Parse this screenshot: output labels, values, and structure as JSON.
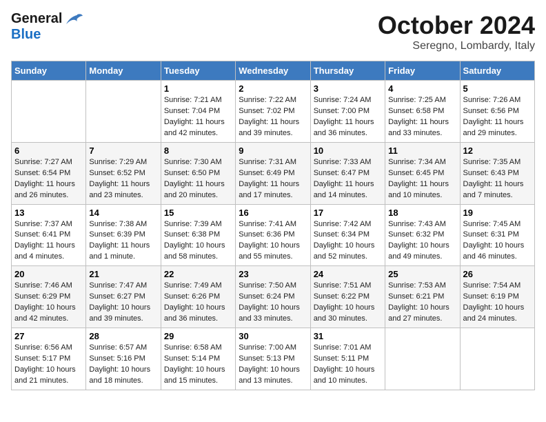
{
  "logo": {
    "general": "General",
    "blue": "Blue"
  },
  "title": "October 2024",
  "subtitle": "Seregno, Lombardy, Italy",
  "days_of_week": [
    "Sunday",
    "Monday",
    "Tuesday",
    "Wednesday",
    "Thursday",
    "Friday",
    "Saturday"
  ],
  "weeks": [
    [
      {
        "day": "",
        "sunrise": "",
        "sunset": "",
        "daylight": ""
      },
      {
        "day": "",
        "sunrise": "",
        "sunset": "",
        "daylight": ""
      },
      {
        "day": "1",
        "sunrise": "Sunrise: 7:21 AM",
        "sunset": "Sunset: 7:04 PM",
        "daylight": "Daylight: 11 hours and 42 minutes."
      },
      {
        "day": "2",
        "sunrise": "Sunrise: 7:22 AM",
        "sunset": "Sunset: 7:02 PM",
        "daylight": "Daylight: 11 hours and 39 minutes."
      },
      {
        "day": "3",
        "sunrise": "Sunrise: 7:24 AM",
        "sunset": "Sunset: 7:00 PM",
        "daylight": "Daylight: 11 hours and 36 minutes."
      },
      {
        "day": "4",
        "sunrise": "Sunrise: 7:25 AM",
        "sunset": "Sunset: 6:58 PM",
        "daylight": "Daylight: 11 hours and 33 minutes."
      },
      {
        "day": "5",
        "sunrise": "Sunrise: 7:26 AM",
        "sunset": "Sunset: 6:56 PM",
        "daylight": "Daylight: 11 hours and 29 minutes."
      }
    ],
    [
      {
        "day": "6",
        "sunrise": "Sunrise: 7:27 AM",
        "sunset": "Sunset: 6:54 PM",
        "daylight": "Daylight: 11 hours and 26 minutes."
      },
      {
        "day": "7",
        "sunrise": "Sunrise: 7:29 AM",
        "sunset": "Sunset: 6:52 PM",
        "daylight": "Daylight: 11 hours and 23 minutes."
      },
      {
        "day": "8",
        "sunrise": "Sunrise: 7:30 AM",
        "sunset": "Sunset: 6:50 PM",
        "daylight": "Daylight: 11 hours and 20 minutes."
      },
      {
        "day": "9",
        "sunrise": "Sunrise: 7:31 AM",
        "sunset": "Sunset: 6:49 PM",
        "daylight": "Daylight: 11 hours and 17 minutes."
      },
      {
        "day": "10",
        "sunrise": "Sunrise: 7:33 AM",
        "sunset": "Sunset: 6:47 PM",
        "daylight": "Daylight: 11 hours and 14 minutes."
      },
      {
        "day": "11",
        "sunrise": "Sunrise: 7:34 AM",
        "sunset": "Sunset: 6:45 PM",
        "daylight": "Daylight: 11 hours and 10 minutes."
      },
      {
        "day": "12",
        "sunrise": "Sunrise: 7:35 AM",
        "sunset": "Sunset: 6:43 PM",
        "daylight": "Daylight: 11 hours and 7 minutes."
      }
    ],
    [
      {
        "day": "13",
        "sunrise": "Sunrise: 7:37 AM",
        "sunset": "Sunset: 6:41 PM",
        "daylight": "Daylight: 11 hours and 4 minutes."
      },
      {
        "day": "14",
        "sunrise": "Sunrise: 7:38 AM",
        "sunset": "Sunset: 6:39 PM",
        "daylight": "Daylight: 11 hours and 1 minute."
      },
      {
        "day": "15",
        "sunrise": "Sunrise: 7:39 AM",
        "sunset": "Sunset: 6:38 PM",
        "daylight": "Daylight: 10 hours and 58 minutes."
      },
      {
        "day": "16",
        "sunrise": "Sunrise: 7:41 AM",
        "sunset": "Sunset: 6:36 PM",
        "daylight": "Daylight: 10 hours and 55 minutes."
      },
      {
        "day": "17",
        "sunrise": "Sunrise: 7:42 AM",
        "sunset": "Sunset: 6:34 PM",
        "daylight": "Daylight: 10 hours and 52 minutes."
      },
      {
        "day": "18",
        "sunrise": "Sunrise: 7:43 AM",
        "sunset": "Sunset: 6:32 PM",
        "daylight": "Daylight: 10 hours and 49 minutes."
      },
      {
        "day": "19",
        "sunrise": "Sunrise: 7:45 AM",
        "sunset": "Sunset: 6:31 PM",
        "daylight": "Daylight: 10 hours and 46 minutes."
      }
    ],
    [
      {
        "day": "20",
        "sunrise": "Sunrise: 7:46 AM",
        "sunset": "Sunset: 6:29 PM",
        "daylight": "Daylight: 10 hours and 42 minutes."
      },
      {
        "day": "21",
        "sunrise": "Sunrise: 7:47 AM",
        "sunset": "Sunset: 6:27 PM",
        "daylight": "Daylight: 10 hours and 39 minutes."
      },
      {
        "day": "22",
        "sunrise": "Sunrise: 7:49 AM",
        "sunset": "Sunset: 6:26 PM",
        "daylight": "Daylight: 10 hours and 36 minutes."
      },
      {
        "day": "23",
        "sunrise": "Sunrise: 7:50 AM",
        "sunset": "Sunset: 6:24 PM",
        "daylight": "Daylight: 10 hours and 33 minutes."
      },
      {
        "day": "24",
        "sunrise": "Sunrise: 7:51 AM",
        "sunset": "Sunset: 6:22 PM",
        "daylight": "Daylight: 10 hours and 30 minutes."
      },
      {
        "day": "25",
        "sunrise": "Sunrise: 7:53 AM",
        "sunset": "Sunset: 6:21 PM",
        "daylight": "Daylight: 10 hours and 27 minutes."
      },
      {
        "day": "26",
        "sunrise": "Sunrise: 7:54 AM",
        "sunset": "Sunset: 6:19 PM",
        "daylight": "Daylight: 10 hours and 24 minutes."
      }
    ],
    [
      {
        "day": "27",
        "sunrise": "Sunrise: 6:56 AM",
        "sunset": "Sunset: 5:17 PM",
        "daylight": "Daylight: 10 hours and 21 minutes."
      },
      {
        "day": "28",
        "sunrise": "Sunrise: 6:57 AM",
        "sunset": "Sunset: 5:16 PM",
        "daylight": "Daylight: 10 hours and 18 minutes."
      },
      {
        "day": "29",
        "sunrise": "Sunrise: 6:58 AM",
        "sunset": "Sunset: 5:14 PM",
        "daylight": "Daylight: 10 hours and 15 minutes."
      },
      {
        "day": "30",
        "sunrise": "Sunrise: 7:00 AM",
        "sunset": "Sunset: 5:13 PM",
        "daylight": "Daylight: 10 hours and 13 minutes."
      },
      {
        "day": "31",
        "sunrise": "Sunrise: 7:01 AM",
        "sunset": "Sunset: 5:11 PM",
        "daylight": "Daylight: 10 hours and 10 minutes."
      },
      {
        "day": "",
        "sunrise": "",
        "sunset": "",
        "daylight": ""
      },
      {
        "day": "",
        "sunrise": "",
        "sunset": "",
        "daylight": ""
      }
    ]
  ]
}
